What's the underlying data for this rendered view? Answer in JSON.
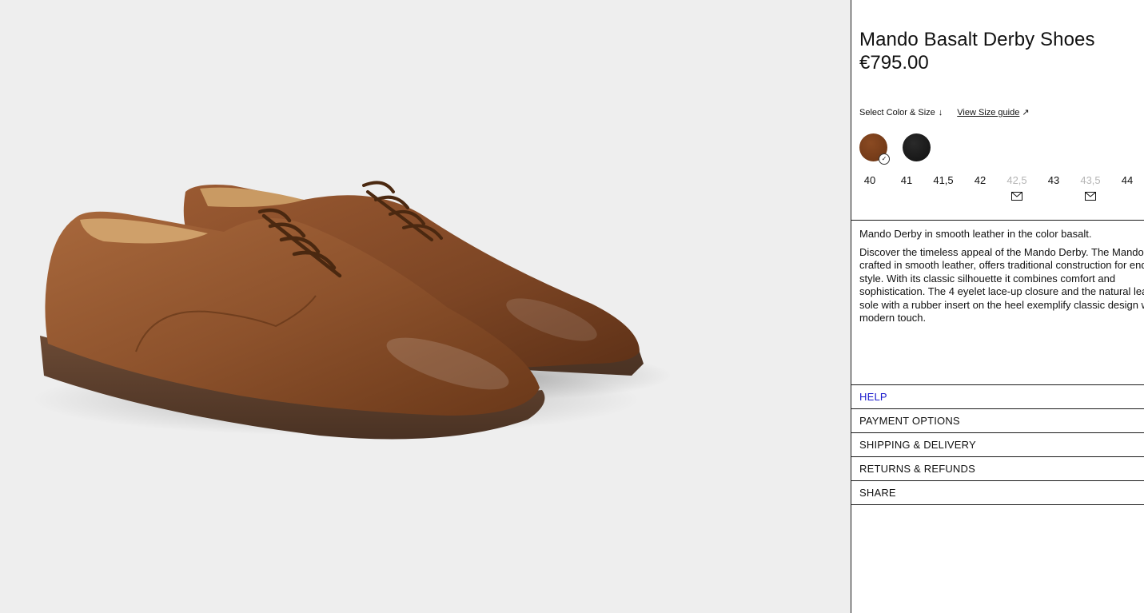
{
  "product": {
    "title": "Mando Basalt Derby Shoes",
    "price": "€795.00"
  },
  "selector": {
    "select_label": "Select Color & Size",
    "select_arrow": "↓",
    "size_guide_label": "View Size guide",
    "size_guide_arrow": "↗",
    "colors": [
      {
        "name": "brown-swatch",
        "color": "#7a3f1a",
        "selected": true
      },
      {
        "name": "black-swatch",
        "color": "#151515",
        "selected": false
      }
    ],
    "check_glyph": "✓",
    "sizes": [
      {
        "label": "40",
        "available": true
      },
      {
        "label": "41",
        "available": true
      },
      {
        "label": "41,5",
        "available": true
      },
      {
        "label": "42",
        "available": true
      },
      {
        "label": "42,5",
        "available": false
      },
      {
        "label": "43",
        "available": true
      },
      {
        "label": "43,5",
        "available": false
      },
      {
        "label": "44",
        "available": true
      }
    ]
  },
  "description": {
    "summary": "Mando Derby in smooth leather in the color basalt.",
    "body": "Discover the timeless appeal of the Mando Derby. The Mando Derby, crafted in smooth leather, offers traditional construction for enduring style. With its classic silhouette it combines comfort and sophistication. The 4 eyelet lace-up closure and the natural leather sole with a rubber insert on the heel exemplify classic design with a modern touch."
  },
  "accordion": {
    "help": "HELP",
    "payment": "PAYMENT OPTIONS",
    "shipping": "SHIPPING & DELIVERY",
    "returns": "RETURNS & REFUNDS",
    "share": "SHARE"
  },
  "colors": {
    "hero_bg": "#eeeeee",
    "link_blue": "#1a1acc",
    "muted": "#b5b5b5"
  }
}
